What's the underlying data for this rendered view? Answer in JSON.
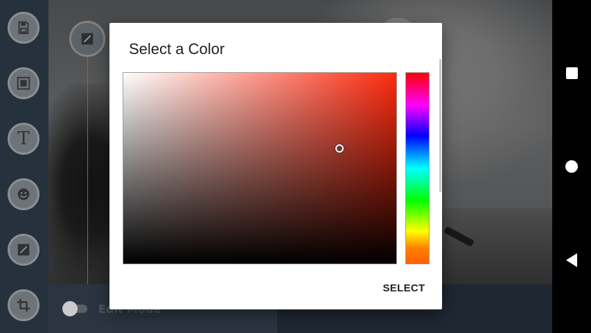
{
  "sidebar": {
    "tools": [
      {
        "icon": "save-icon"
      },
      {
        "icon": "image-icon"
      },
      {
        "icon": "text-icon",
        "glyph": "T"
      },
      {
        "icon": "sticker-icon"
      },
      {
        "icon": "brush-icon"
      },
      {
        "icon": "crop-icon"
      }
    ]
  },
  "bottom": {
    "edit_mode_label": "Edit Mode",
    "edit_mode_on": false
  },
  "dialog": {
    "title": "Select a Color",
    "select_label": "SELECT",
    "hue_color": "#ff2a0f",
    "selected_color": "#c33a2c"
  },
  "navbar": {
    "icons": [
      "recents-icon",
      "home-icon",
      "back-icon"
    ]
  }
}
